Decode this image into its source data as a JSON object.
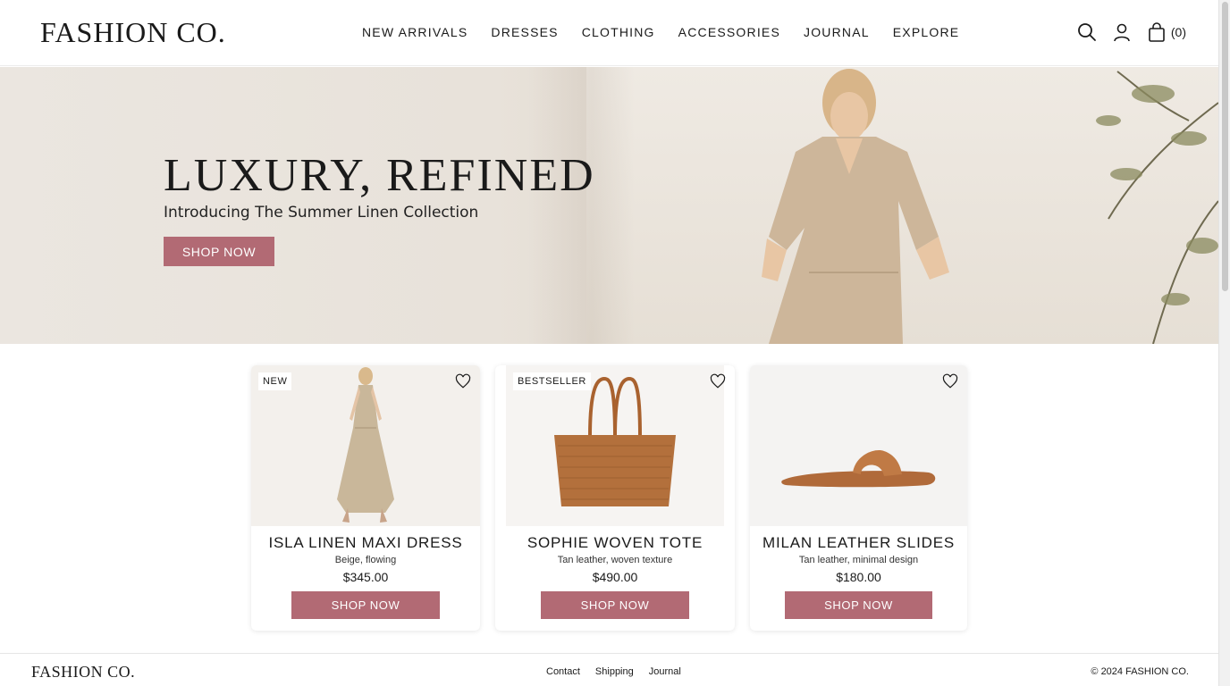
{
  "brand": {
    "logo": "FASHION CO."
  },
  "nav": {
    "items": [
      {
        "label": "NEW ARRIVALS"
      },
      {
        "label": "DRESSES"
      },
      {
        "label": "CLOTHING"
      },
      {
        "label": "ACCESSORIES"
      },
      {
        "label": "JOURNAL"
      },
      {
        "label": "EXPLORE"
      }
    ]
  },
  "header": {
    "icons": [
      "search-icon",
      "user-icon",
      "shopping-bag-icon"
    ],
    "cart_count": "(0)"
  },
  "hero": {
    "title": "LUXURY, REFINED",
    "subtitle": "Introducing The Summer Linen Collection",
    "cta": "SHOP NOW"
  },
  "products": [
    {
      "badge": "NEW",
      "name": "ISLA LINEN MAXI DRESS",
      "desc": "Beige, flowing",
      "price": "$345.00",
      "cta": "SHOP NOW"
    },
    {
      "badge": "BESTSELLER",
      "name": "SOPHIE WOVEN TOTE",
      "desc": "Tan leather, woven texture",
      "price": "$490.00",
      "cta": "SHOP NOW"
    },
    {
      "badge": "",
      "name": "MILAN LEATHER SLIDES",
      "desc": "Tan leather, minimal design",
      "price": "$180.00",
      "cta": "SHOP NOW"
    }
  ],
  "footer": {
    "logo": "FASHION CO.",
    "links": [
      {
        "label": "Contact"
      },
      {
        "label": "Shipping"
      },
      {
        "label": "Journal"
      }
    ],
    "copyright": "© 2024 FASHION CO."
  },
  "colors": {
    "accent": "#b26a74",
    "text": "#1a1a1a",
    "tan": "#b06a3a"
  }
}
